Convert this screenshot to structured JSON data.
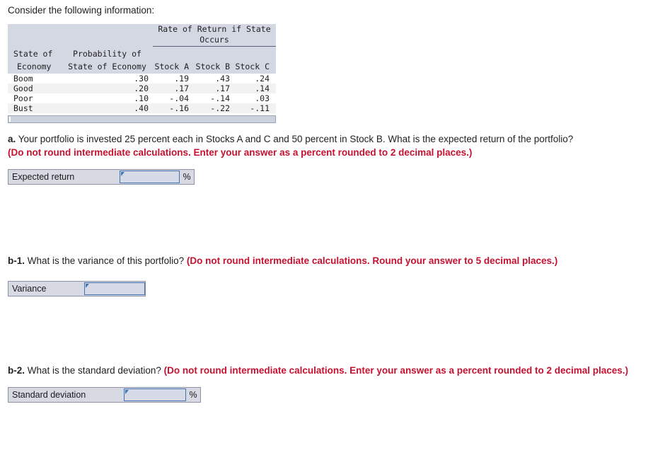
{
  "intro": "Consider the following information:",
  "table": {
    "span_header": "Rate of Return if State Occurs",
    "columns": [
      "State of Economy",
      "Probability of State of Economy",
      "Stock A",
      "Stock B",
      "Stock C"
    ],
    "column_header_lines": {
      "state_l1": "State of",
      "state_l2": "Economy",
      "prob_l1": "Probability of",
      "prob_l2": "State of Economy",
      "stock_a": "Stock A",
      "stock_b": "Stock B",
      "stock_c": "Stock C"
    },
    "rows": [
      {
        "state": "Boom",
        "probability": ".30",
        "stock_a": ".19",
        "stock_b": ".43",
        "stock_c": ".24"
      },
      {
        "state": "Good",
        "probability": ".20",
        "stock_a": ".17",
        "stock_b": ".17",
        "stock_c": ".14"
      },
      {
        "state": "Poor",
        "probability": ".10",
        "stock_a": "-.04",
        "stock_b": "-.14",
        "stock_c": ".03"
      },
      {
        "state": "Bust",
        "probability": ".40",
        "stock_a": "-.16",
        "stock_b": "-.22",
        "stock_c": "-.11"
      }
    ]
  },
  "questions": {
    "a": {
      "label": "a.",
      "prompt": " Your portfolio is invested 25 percent each in Stocks A and C and 50 percent in Stock B. What is the expected return of the portfolio? ",
      "hint": "(Do not round intermediate calculations. Enter your answer as a percent rounded to 2 decimal places.)",
      "answer": {
        "label": "Expected return",
        "value": "",
        "placeholder": "",
        "unit": "%"
      }
    },
    "b1": {
      "label": "b-1.",
      "prompt": " What is the variance of this portfolio? ",
      "hint": "(Do not round intermediate calculations. Round your answer to 5 decimal places.)",
      "answer": {
        "label": "Variance",
        "value": "",
        "placeholder": "",
        "unit": ""
      }
    },
    "b2": {
      "label": "b-2.",
      "prompt": " What is the standard deviation? ",
      "hint": "(Do not round intermediate calculations. Enter your answer as a percent rounded to 2 decimal places.)",
      "answer": {
        "label": "Standard deviation",
        "value": "",
        "placeholder": "",
        "unit": "%"
      }
    }
  },
  "colors": {
    "hint_red": "#c41230",
    "header_band": "#d3d8e3",
    "widget_bg": "#d7dae3",
    "input_border": "#3f73b5",
    "input_bg": "#d5dae6",
    "scrollbar": "#ccd1de"
  }
}
